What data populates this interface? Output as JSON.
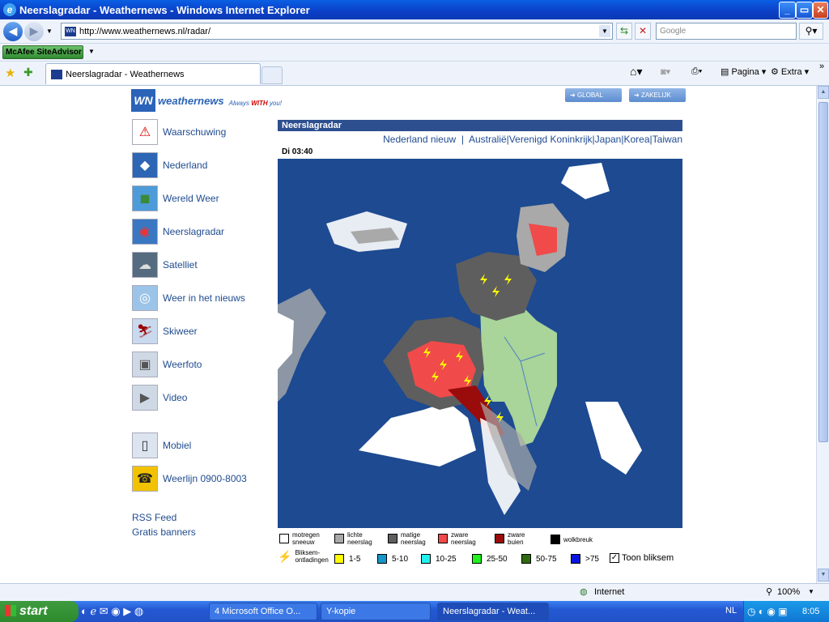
{
  "window": {
    "title": "Neerslagradar - Weathernews - Windows Internet Explorer"
  },
  "browser": {
    "address": "http://www.weathernews.nl/radar/",
    "search_placeholder": "Google",
    "mcafee_label": "McAfee SiteAdvisor",
    "tab_title": "Neerslagradar - Weathernews",
    "tools": {
      "page": "Pagina",
      "extra": "Extra"
    }
  },
  "site": {
    "logo_initials": "WN",
    "logo_name": "weathernews",
    "tagline_pre": "Always",
    "tagline_with": "WITH",
    "tagline_post": "you!",
    "header_buttons": [
      "GLOBAL",
      "ZAKELIJK"
    ],
    "nav": [
      {
        "label": "Waarschuwing",
        "icon": "warning-icon"
      },
      {
        "label": "Nederland",
        "icon": "netherlands-map-icon"
      },
      {
        "label": "Wereld Weer",
        "icon": "world-map-icon"
      },
      {
        "label": "Neerslagradar",
        "icon": "radar-icon"
      },
      {
        "label": "Satelliet",
        "icon": "satellite-icon"
      },
      {
        "label": "Weer in het nieuws",
        "icon": "storm-icon"
      },
      {
        "label": "Skiweer",
        "icon": "skier-icon"
      },
      {
        "label": "Weerfoto",
        "icon": "camera-icon"
      },
      {
        "label": "Video",
        "icon": "video-icon"
      },
      {
        "label": "Mobiel",
        "icon": "phone-icon"
      },
      {
        "label": "Weerlijn 0900-8003",
        "icon": "telephone-icon"
      }
    ],
    "links": [
      "RSS Feed",
      "Gratis banners"
    ]
  },
  "radar": {
    "section_title": "Neerslagradar",
    "regions": [
      "Nederland nieuw",
      "Australië",
      "Verenigd Koninkrijk",
      "Japan",
      "Korea",
      "Taiwan"
    ],
    "timestamp": "Di 03:40",
    "legend_precip": [
      {
        "label": "motregen sneeuw",
        "color": "#ffffff"
      },
      {
        "label": "lichte neerslag",
        "color": "#a9a9a9"
      },
      {
        "label": "matige neerslag",
        "color": "#5e5e5e"
      },
      {
        "label": "zware neerslag",
        "color": "#f04a4a"
      },
      {
        "label": "zware buien",
        "color": "#9a0b0b"
      },
      {
        "label": "wolkbreuk",
        "color": "#000000"
      }
    ],
    "legend_lightning_label": "Bliksem-ontladingen",
    "legend_lightning": [
      {
        "label": "1-5",
        "color": "#ffff00"
      },
      {
        "label": "5-10",
        "color": "#1796c8"
      },
      {
        "label": "10-25",
        "color": "#22f0f0"
      },
      {
        "label": "25-50",
        "color": "#22f022"
      },
      {
        "label": "50-75",
        "color": "#2f6a12"
      },
      {
        "label": ">75",
        "color": "#0a14e0"
      }
    ],
    "toggle_label": "Toon bliksem",
    "toggle_checked": true
  },
  "statusbar": {
    "zone": "Internet",
    "zoom": "100%"
  },
  "taskbar": {
    "start": "start",
    "tasks": [
      "4 Microsoft Office O...",
      "Y-kopie",
      "Neerslagradar - Weat..."
    ],
    "lang": "NL",
    "clock": "8:05"
  }
}
